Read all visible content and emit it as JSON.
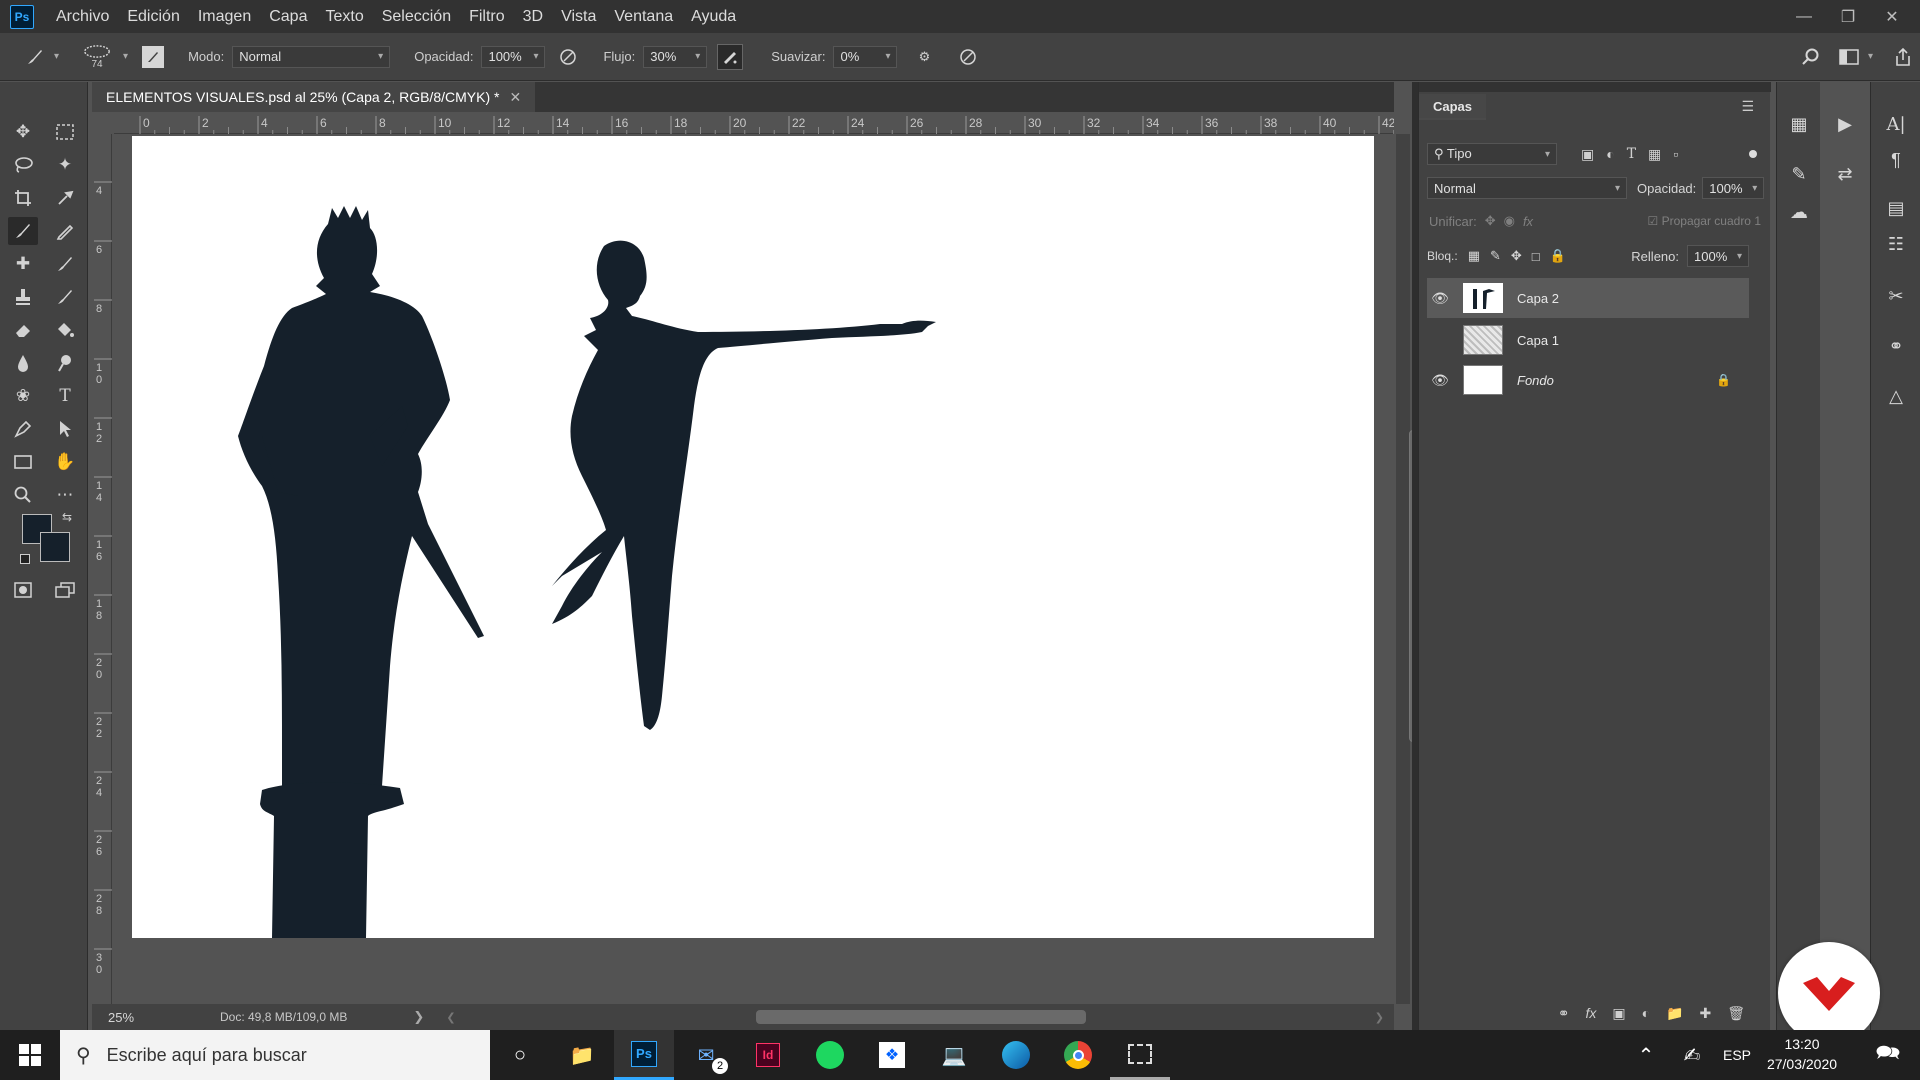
{
  "app": {
    "logo": "Ps"
  },
  "menu": [
    "Archivo",
    "Edición",
    "Imagen",
    "Capa",
    "Texto",
    "Selección",
    "Filtro",
    "3D",
    "Vista",
    "Ventana",
    "Ayuda"
  ],
  "options": {
    "brush_size": "74",
    "mode_label": "Modo:",
    "mode_value": "Normal",
    "opacity_label": "Opacidad:",
    "opacity_value": "100%",
    "flow_label": "Flujo:",
    "flow_value": "30%",
    "smooth_label": "Suavizar:",
    "smooth_value": "0%"
  },
  "document": {
    "tab_title": "ELEMENTOS VISUALES.psd al 25% (Capa 2, RGB/8/CMYK) *",
    "zoom": "25%",
    "doc_info": "Doc: 49,8 MB/109,0 MB"
  },
  "rulers": {
    "h_labels": [
      "0",
      "2",
      "4",
      "6",
      "8",
      "10",
      "12",
      "14",
      "16",
      "18",
      "20",
      "22",
      "24",
      "26",
      "28",
      "30",
      "32",
      "34",
      "36",
      "38",
      "40",
      "42"
    ],
    "v_labels": [
      "4",
      "6",
      "8",
      "1 0",
      "1 2",
      "1 4",
      "1 6",
      "1 8",
      "2 0",
      "2 2",
      "2 4",
      "2 6",
      "2 8",
      "3 0"
    ]
  },
  "layers_panel": {
    "tab": "Capas",
    "filter_value": "Tipo",
    "blend_mode": "Normal",
    "opacity_label": "Opacidad:",
    "opacity_value": "100%",
    "unify_label": "Unificar:",
    "propagate_label": "Propagar cuadro 1",
    "lock_label": "Bloq.:",
    "fill_label": "Relleno:",
    "fill_value": "100%",
    "layers": [
      {
        "name": "Capa 2",
        "visible": true,
        "selected": true
      },
      {
        "name": "Capa 1",
        "visible": false,
        "selected": false
      },
      {
        "name": "Fondo",
        "visible": true,
        "selected": false,
        "locked": true
      }
    ]
  },
  "taskbar": {
    "search_placeholder": "Escribe aquí para buscar",
    "mail_badge": "2",
    "language": "ESP",
    "time": "13:20",
    "date": "27/03/2020"
  },
  "colors": {
    "ui_dark": "#323232",
    "ui_panel": "#424242",
    "ui_workspace": "#535353",
    "ps_blue": "#31a8ff",
    "ink": "#15202b",
    "badge_red": "#d81e1e"
  }
}
